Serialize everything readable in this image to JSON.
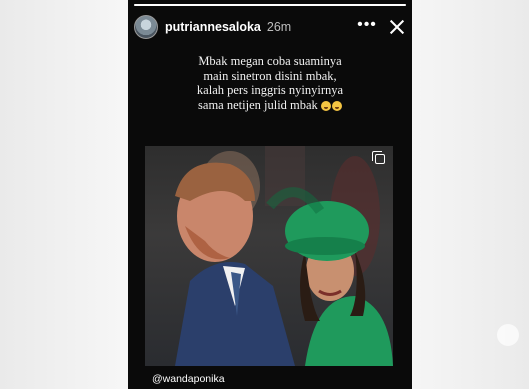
{
  "story": {
    "username": "putriannesaloka",
    "time_ago": "26m",
    "more_label": "•••",
    "progress": 1.0,
    "caption_lines": [
      "Mbak megan coba suaminya",
      "main sinetron disini mbak,",
      "kalah pers inggris nyinyirnya",
      "sama netijen julid mbak"
    ],
    "caption_emojis": [
      "grinning-sweat-emoji",
      "joy-emoji"
    ],
    "photo_desc_icon": "multiple-photos-icon",
    "mention": "@wandaponika"
  },
  "colors": {
    "story_bg": "#0a0a0a",
    "text": "#ffffff",
    "hat_green": "#1f9a5c",
    "suit_navy": "#2b3f6b"
  }
}
